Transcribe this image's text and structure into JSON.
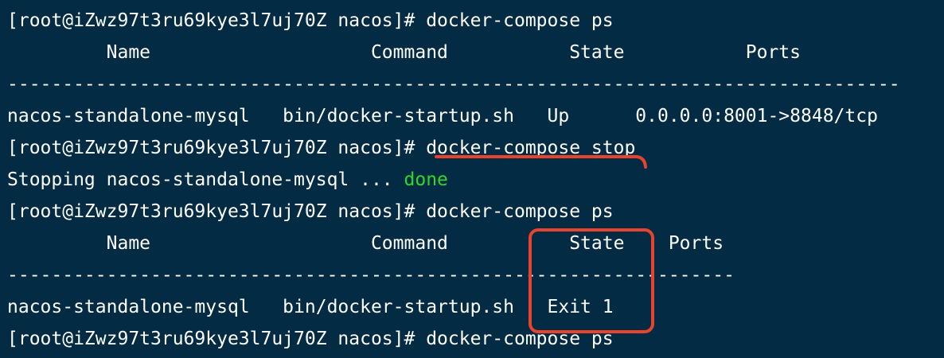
{
  "terminal": {
    "lines": [
      "[root@iZwz97t3ru69kye3l7uj70Z nacos]# docker-compose ps",
      "         Name                    Command           State           Ports         ",
      "---------------------------------------------------------------------------------",
      "nacos-standalone-mysql   bin/docker-startup.sh   Up      0.0.0.0:8001->8848/tcp",
      "[root@iZwz97t3ru69kye3l7uj70Z nacos]# docker-compose stop",
      "Stopping nacos-standalone-mysql ... ",
      "[root@iZwz97t3ru69kye3l7uj70Z nacos]# docker-compose ps",
      "         Name                    Command           State    Ports",
      "------------------------------------------------------------------",
      "nacos-standalone-mysql   bin/docker-startup.sh   Exit 1",
      "[root@iZwz97t3ru69kye3l7uj70Z nacos]# docker-compose ps"
    ],
    "done_label": "done"
  },
  "colors": {
    "background": "#032b43",
    "text": "#ffffff",
    "success": "#2bd92b",
    "annotation": "#e8432c"
  }
}
